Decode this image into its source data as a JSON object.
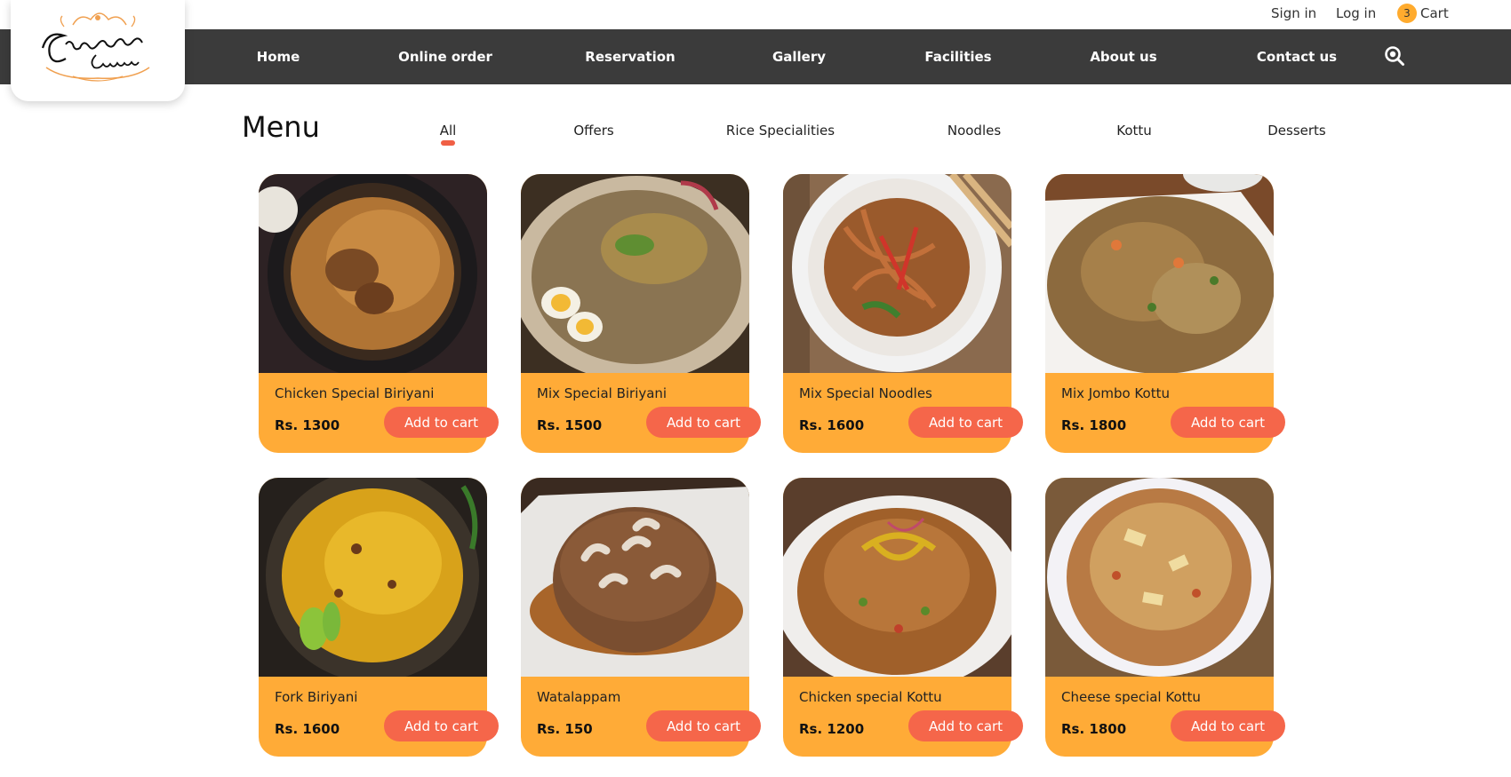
{
  "top_links": {
    "sign_in": "Sign in",
    "log_in": "Log in",
    "cart_count": "3",
    "cart_label": "Cart"
  },
  "nav": {
    "items": [
      "Home",
      "Online order",
      "Reservation",
      "Gallery",
      "Facilities",
      "About us",
      "Contact us"
    ],
    "search_icon": "search-icon"
  },
  "logo": {
    "alt": "Signature Cuisine logo"
  },
  "menu": {
    "title": "Menu",
    "categories": [
      "All",
      "Offers",
      "Rice Specialities",
      "Noodles",
      "Kottu",
      "Desserts"
    ],
    "active_category": "All"
  },
  "add_to_cart_label": "Add to cart",
  "products": [
    {
      "name": "Chicken Special Biriyani",
      "price": "Rs. 1300"
    },
    {
      "name": "Mix Special Biriyani",
      "price": "Rs. 1500"
    },
    {
      "name": "Mix Special Noodles",
      "price": "Rs. 1600"
    },
    {
      "name": "Mix Jombo Kottu",
      "price": "Rs. 1800"
    },
    {
      "name": "Fork Biriyani",
      "price": "Rs. 1600"
    },
    {
      "name": "Watalappam",
      "price": "Rs. 150"
    },
    {
      "name": "Chicken special Kottu",
      "price": "Rs. 1200"
    },
    {
      "name": "Cheese special Kottu",
      "price": "Rs. 1800"
    }
  ],
  "colors": {
    "accent": "#f5664a",
    "card": "#ffab37",
    "nav": "#3b3b3b",
    "badge": "#ffab2e"
  }
}
